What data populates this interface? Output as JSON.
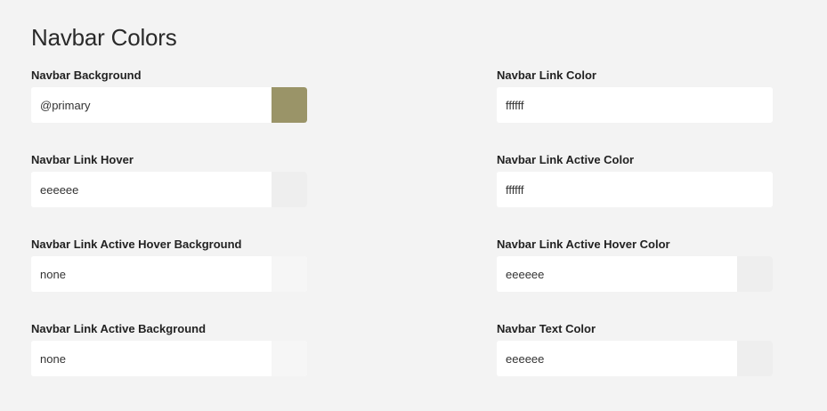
{
  "section": {
    "title": "Navbar Colors"
  },
  "fields": {
    "navbar_background": {
      "label": "Navbar Background",
      "value": "@primary",
      "swatch_color": "#9a9468"
    },
    "navbar_link_color": {
      "label": "Navbar Link Color",
      "value": "ffffff",
      "swatch_color": "#ffffff"
    },
    "navbar_link_hover": {
      "label": "Navbar Link Hover",
      "value": "eeeeee",
      "swatch_color": "#eeeeee"
    },
    "navbar_link_active_color": {
      "label": "Navbar Link Active Color",
      "value": "ffffff",
      "swatch_color": "#ffffff"
    },
    "navbar_link_active_hover_background": {
      "label": "Navbar Link Active Hover Background",
      "value": "none",
      "swatch_color": "#f6f6f6"
    },
    "navbar_link_active_hover_color": {
      "label": "Navbar Link Active Hover Color",
      "value": "eeeeee",
      "swatch_color": "#eeeeee"
    },
    "navbar_link_active_background": {
      "label": "Navbar Link Active Background",
      "value": "none",
      "swatch_color": "#f6f6f6"
    },
    "navbar_text_color": {
      "label": "Navbar Text Color",
      "value": "eeeeee",
      "swatch_color": "#eeeeee"
    }
  }
}
